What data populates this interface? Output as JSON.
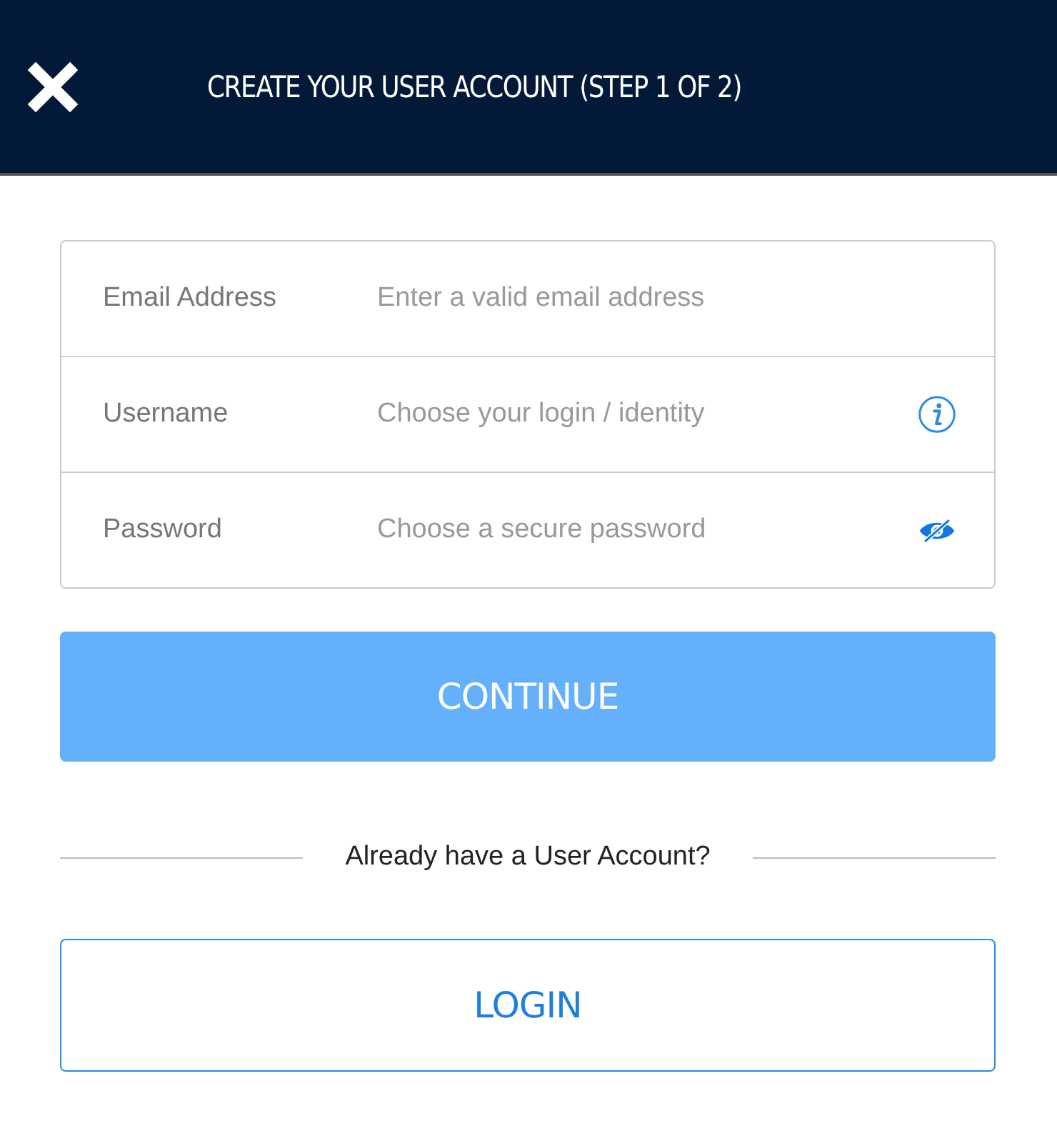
{
  "header": {
    "title": "CREATE YOUR USER ACCOUNT (STEP 1 OF 2)"
  },
  "fields": [
    {
      "label": "Email Address",
      "placeholder": "Enter a valid email address",
      "kind": "email"
    },
    {
      "label": "Username",
      "placeholder": "Choose your login / identity",
      "kind": "username"
    },
    {
      "label": "Password",
      "placeholder": "Choose a secure password",
      "kind": "password"
    }
  ],
  "continue_button": {
    "label": "CONTINUE",
    "disabled": true
  },
  "divider_text": "Already have a User Account?",
  "login_button": {
    "label": "LOGIN"
  }
}
